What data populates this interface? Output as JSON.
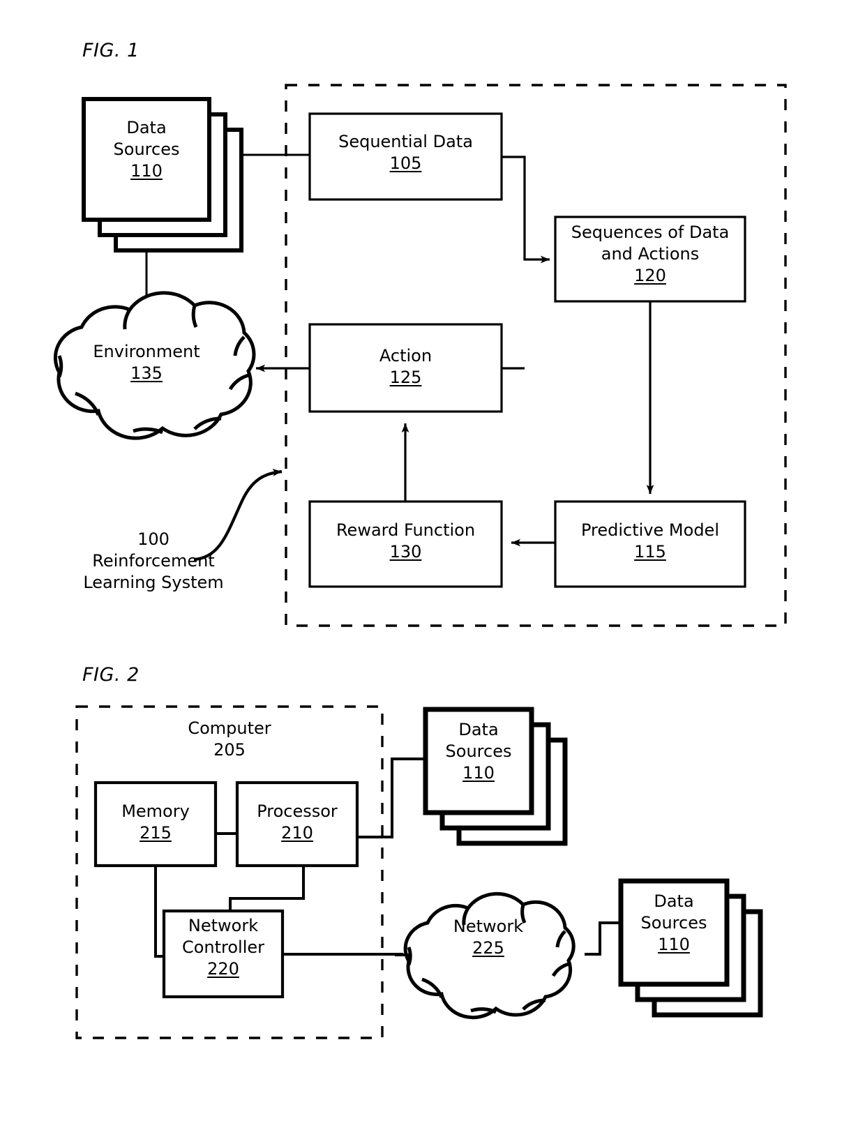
{
  "document": {
    "type": "patent-figure-sheet",
    "figures": [
      {
        "caption": "FIG. 1",
        "title": "Reinforcement Learning System",
        "system_number": "100",
        "system_label_line1": "100",
        "system_label_line2": "Reinforcement",
        "system_label_line3": "Learning System",
        "boundary": "dashed",
        "nodes": [
          {
            "id": "data-sources",
            "name": "Data Sources",
            "number": "110",
            "shape": "stacked-box",
            "line1": "Data",
            "line2": "Sources",
            "underlined": true
          },
          {
            "id": "sequential-data",
            "name": "Sequential Data",
            "number": "105",
            "shape": "box",
            "line1": "Sequential Data",
            "underlined": true
          },
          {
            "id": "sequences-of-data-and-actions",
            "name": "Sequences of Data and Actions",
            "number": "120",
            "shape": "box",
            "line1": "Sequences of Data",
            "line2": "and Actions",
            "underlined": true
          },
          {
            "id": "predictive-model",
            "name": "Predictive Model",
            "number": "115",
            "shape": "box",
            "line1": "Predictive Model",
            "underlined": true
          },
          {
            "id": "reward-function",
            "name": "Reward Function",
            "number": "130",
            "shape": "box",
            "line1": "Reward Function",
            "underlined": true
          },
          {
            "id": "action",
            "name": "Action",
            "number": "125",
            "shape": "box",
            "line1": "Action",
            "underlined": true
          },
          {
            "id": "environment",
            "name": "Environment",
            "number": "135",
            "shape": "cloud",
            "line1": "Environment",
            "underlined": true
          }
        ],
        "edges": [
          {
            "from": "data-sources",
            "to": "sequential-data",
            "arrow": true
          },
          {
            "from": "data-sources",
            "to": "environment",
            "arrow": false
          },
          {
            "from": "sequential-data",
            "to": "sequences-of-data-and-actions",
            "arrow": true
          },
          {
            "from": "sequences-of-data-and-actions",
            "to": "predictive-model",
            "arrow": true
          },
          {
            "from": "predictive-model",
            "to": "reward-function",
            "arrow": true
          },
          {
            "from": "reward-function",
            "to": "action",
            "arrow": true
          },
          {
            "from": "action",
            "to": "environment",
            "arrow": true
          },
          {
            "from": "action",
            "to": "sequences-of-data-and-actions",
            "arrow": false
          }
        ]
      },
      {
        "caption": "FIG. 2",
        "boundary": "dashed",
        "nodes": [
          {
            "id": "computer",
            "name": "Computer",
            "number": "205",
            "shape": "dashed-boundary",
            "line1": "Computer",
            "underlined": false
          },
          {
            "id": "memory",
            "name": "Memory",
            "number": "215",
            "shape": "box",
            "line1": "Memory",
            "underlined": true
          },
          {
            "id": "processor",
            "name": "Processor",
            "number": "210",
            "shape": "box",
            "line1": "Processor",
            "underlined": true
          },
          {
            "id": "network-controller",
            "name": "Network Controller",
            "number": "220",
            "shape": "box",
            "line1": "Network",
            "line2": "Controller",
            "underlined": true
          },
          {
            "id": "data-sources-top",
            "name": "Data Sources",
            "number": "110",
            "shape": "stacked-box",
            "line1": "Data",
            "line2": "Sources",
            "underlined": true
          },
          {
            "id": "network",
            "name": "Network",
            "number": "225",
            "shape": "cloud",
            "line1": "Network",
            "underlined": true
          },
          {
            "id": "data-sources-bottom",
            "name": "Data Sources",
            "number": "110",
            "shape": "stacked-box",
            "line1": "Data",
            "line2": "Sources",
            "underlined": true
          }
        ],
        "edges": [
          {
            "from": "memory",
            "to": "processor",
            "arrow": false
          },
          {
            "from": "memory",
            "to": "network-controller",
            "arrow": false
          },
          {
            "from": "processor",
            "to": "network-controller",
            "arrow": false
          },
          {
            "from": "processor",
            "to": "data-sources-top",
            "arrow": false
          },
          {
            "from": "network-controller",
            "to": "network",
            "arrow": false
          },
          {
            "from": "network",
            "to": "data-sources-bottom",
            "arrow": false
          }
        ]
      }
    ]
  },
  "colors": {
    "stroke": "#000000",
    "background": "#ffffff",
    "text": "#000000"
  }
}
